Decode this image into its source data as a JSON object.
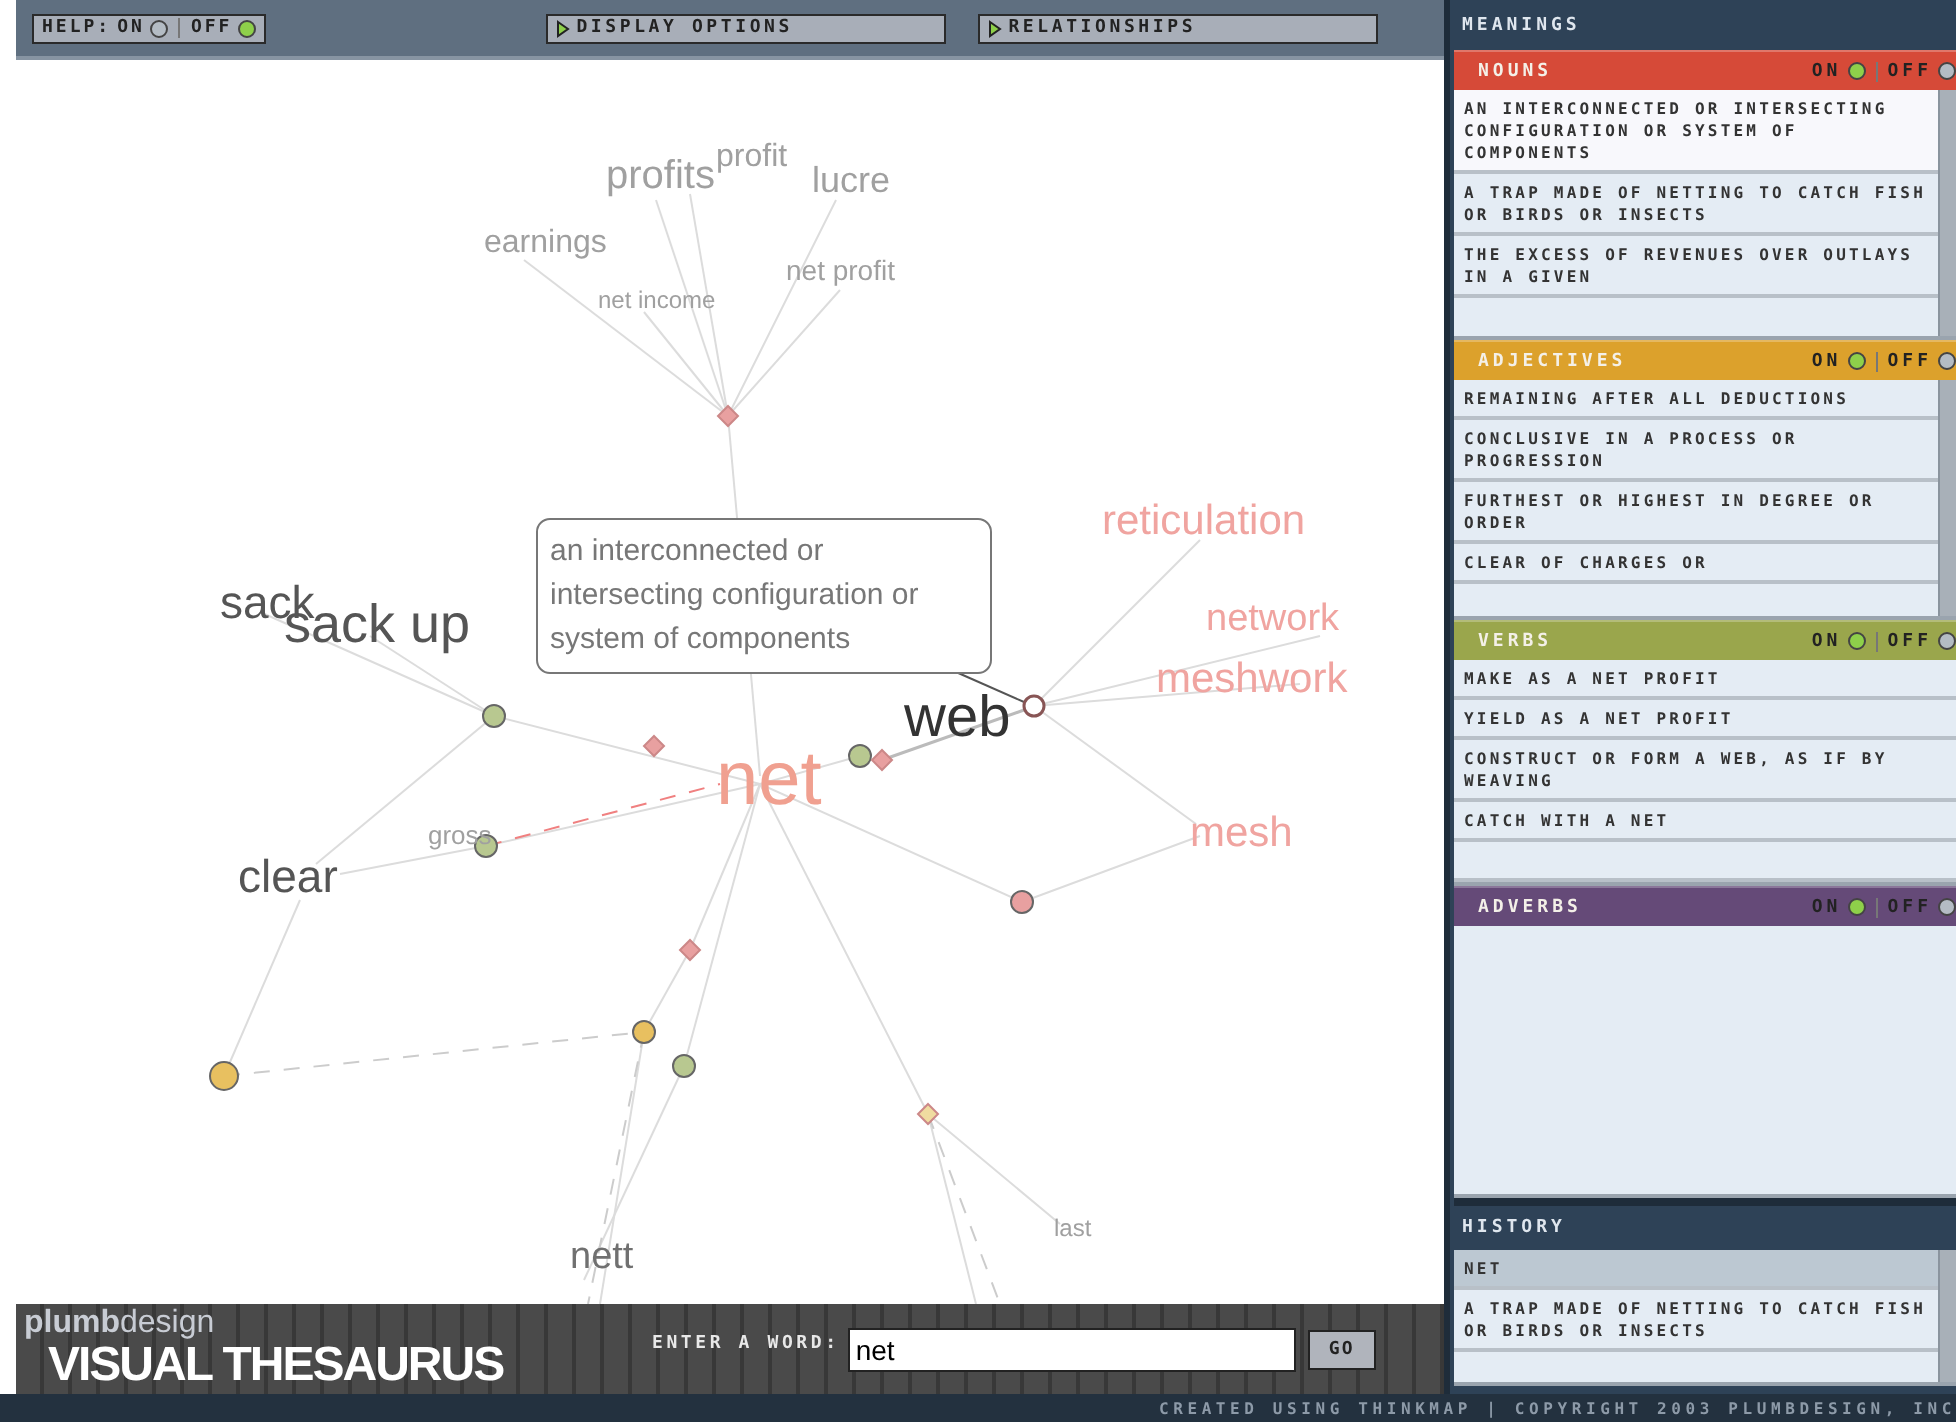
{
  "toolbar": {
    "help": {
      "label": "HELP:",
      "on_label": "ON",
      "off_label": "OFF",
      "on": false
    },
    "buttons": [
      "DISPLAY OPTIONS",
      "RELATIONSHIPS"
    ]
  },
  "graph": {
    "words": [
      {
        "text": "profits",
        "color": "#a0a0a0"
      },
      {
        "text": "profit",
        "color": "#a0a0a0"
      },
      {
        "text": "lucre",
        "color": "#a0a0a0"
      },
      {
        "text": "earnings",
        "color": "#a0a0a0"
      },
      {
        "text": "net profit",
        "color": "#a0a0a0"
      },
      {
        "text": "net income",
        "color": "#a0a0a0"
      },
      {
        "text": "reticulation",
        "color": "#f0a4a0"
      },
      {
        "text": "network",
        "color": "#f0a4a0"
      },
      {
        "text": "meshwork",
        "color": "#f0a4a0"
      },
      {
        "text": "sack",
        "color": "#555555"
      },
      {
        "text": "sack up",
        "color": "#555555"
      },
      {
        "text": "web",
        "color": "#333333"
      },
      {
        "text": "net",
        "color": "#f0a090"
      },
      {
        "text": "gross",
        "color": "#a0a0a0"
      },
      {
        "text": "clear",
        "color": "#555555"
      },
      {
        "text": "mesh",
        "color": "#f0a4a0"
      },
      {
        "text": "nett",
        "color": "#707070"
      },
      {
        "text": "last",
        "color": "#a0a0a0"
      }
    ],
    "nodes": [
      {
        "color": "#e8a0a0",
        "kind": "diamond"
      },
      {
        "color": "#b8c890",
        "kind": "circle"
      },
      {
        "color": "#e8a0a0",
        "kind": "diamond"
      },
      {
        "color": "#b8c890",
        "kind": "circle"
      },
      {
        "color": "#e8a0a0",
        "kind": "diamond"
      },
      {
        "color": "#ffffff",
        "kind": "ring"
      },
      {
        "color": "#b8c890",
        "kind": "circle"
      },
      {
        "color": "#e8a0a0",
        "kind": "circle"
      },
      {
        "color": "#e8a0a0",
        "kind": "diamond"
      },
      {
        "color": "#e8c060",
        "kind": "circle"
      },
      {
        "color": "#b8c890",
        "kind": "circle"
      },
      {
        "color": "#e8c060",
        "kind": "circle"
      },
      {
        "color": "#f0dca0",
        "kind": "diamond"
      }
    ],
    "tooltip": "an interconnected or intersecting configuration or system of components"
  },
  "entry": {
    "brand_prefix": "plumb",
    "brand_suffix": "design",
    "title": "VISUAL THESAURUS",
    "label": "ENTER A WORD:",
    "value": "net",
    "button": "GO"
  },
  "meanings": {
    "title": "MEANINGS",
    "sections": [
      {
        "name": "NOUNS",
        "color": "#d64a38",
        "on_label": "ON",
        "off_label": "OFF",
        "on": true,
        "items": [
          {
            "text": "AN INTERCONNECTED OR INTERSECTING CONFIGURATION OR SYSTEM OF COMPONENTS",
            "selected": true
          },
          {
            "text": "A TRAP MADE OF NETTING TO CATCH FISH OR BIRDS OR INSECTS",
            "selected": false
          },
          {
            "text": "THE EXCESS OF REVENUES OVER OUTLAYS IN A GIVEN",
            "selected": false
          }
        ]
      },
      {
        "name": "ADJECTIVES",
        "color": "#dca12c",
        "on_label": "ON",
        "off_label": "OFF",
        "on": true,
        "items": [
          {
            "text": "REMAINING AFTER ALL DEDUCTIONS",
            "selected": false
          },
          {
            "text": "CONCLUSIVE IN A PROCESS OR PROGRESSION",
            "selected": false
          },
          {
            "text": "FURTHEST OR HIGHEST IN DEGREE OR ORDER",
            "selected": false
          },
          {
            "text": "CLEAR OF CHARGES OR",
            "selected": false
          }
        ]
      },
      {
        "name": "VERBS",
        "color": "#9aa64c",
        "on_label": "ON",
        "off_label": "OFF",
        "on": true,
        "items": [
          {
            "text": "MAKE AS A NET PROFIT",
            "selected": false
          },
          {
            "text": "YIELD AS A NET PROFIT",
            "selected": false
          },
          {
            "text": "CONSTRUCT OR FORM A WEB, AS IF BY WEAVING",
            "selected": false
          },
          {
            "text": "CATCH WITH A NET",
            "selected": false
          }
        ]
      },
      {
        "name": "ADVERBS",
        "color": "#654a78",
        "on_label": "ON",
        "off_label": "OFF",
        "on": true
      }
    ]
  },
  "history": {
    "title": "HISTORY",
    "items": [
      {
        "text": "NET",
        "selected": true
      },
      {
        "text": "A TRAP MADE OF NETTING TO CATCH FISH OR BIRDS OR INSECTS",
        "selected": false
      }
    ]
  },
  "footer": "CREATED USING THINKMAP | COPYRIGHT 2003 PLUMBDESIGN, INC"
}
